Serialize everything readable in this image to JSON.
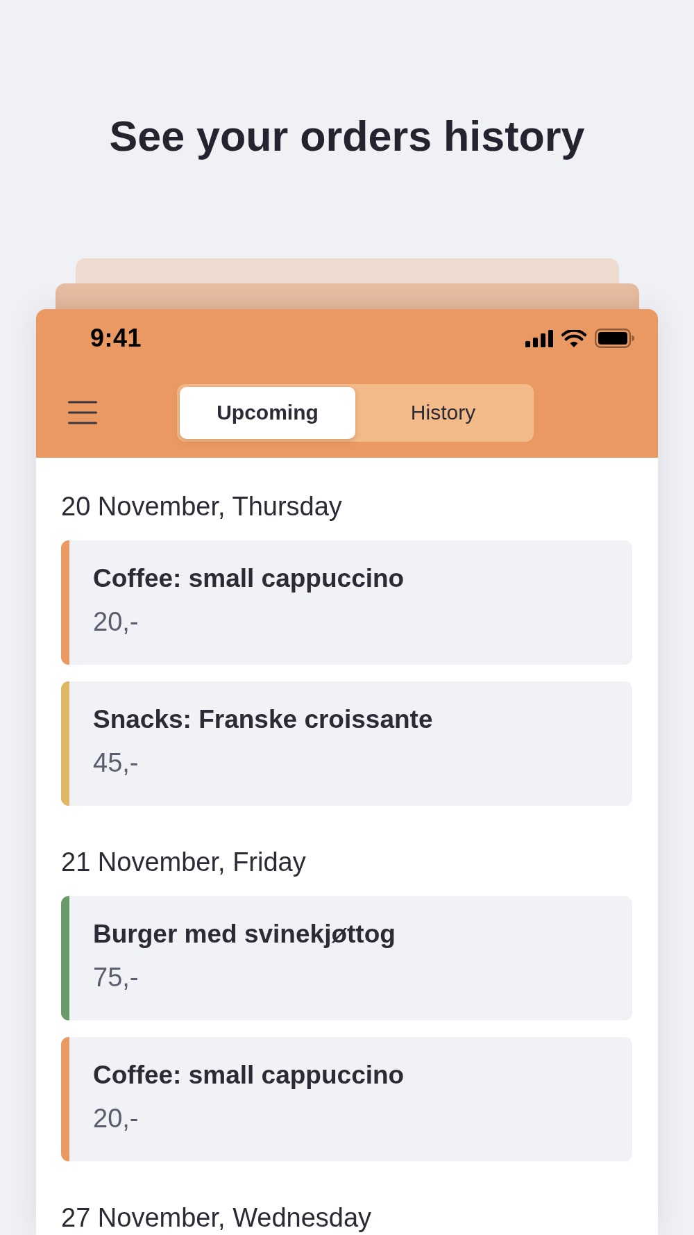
{
  "headline": "See your orders history",
  "status_bar": {
    "time": "9:41"
  },
  "tabs": [
    {
      "label": "Upcoming",
      "selected": true
    },
    {
      "label": "History",
      "selected": false
    }
  ],
  "days": [
    {
      "date": "20 November, Thursday",
      "orders": [
        {
          "title": "Coffee: small cappuccino",
          "price": "20,-",
          "color": "#ea9962"
        },
        {
          "title": "Snacks: Franske croissante",
          "price": "45,-",
          "color": "#dfb765"
        }
      ]
    },
    {
      "date": "21 November, Friday",
      "orders": [
        {
          "title": "Burger med svinekjøttog",
          "price": "75,-",
          "color": "#6a9a68"
        },
        {
          "title": "Coffee: small cappuccino",
          "price": "20,-",
          "color": "#ea9962"
        }
      ]
    },
    {
      "date": "27 November, Wednesday"
    }
  ]
}
